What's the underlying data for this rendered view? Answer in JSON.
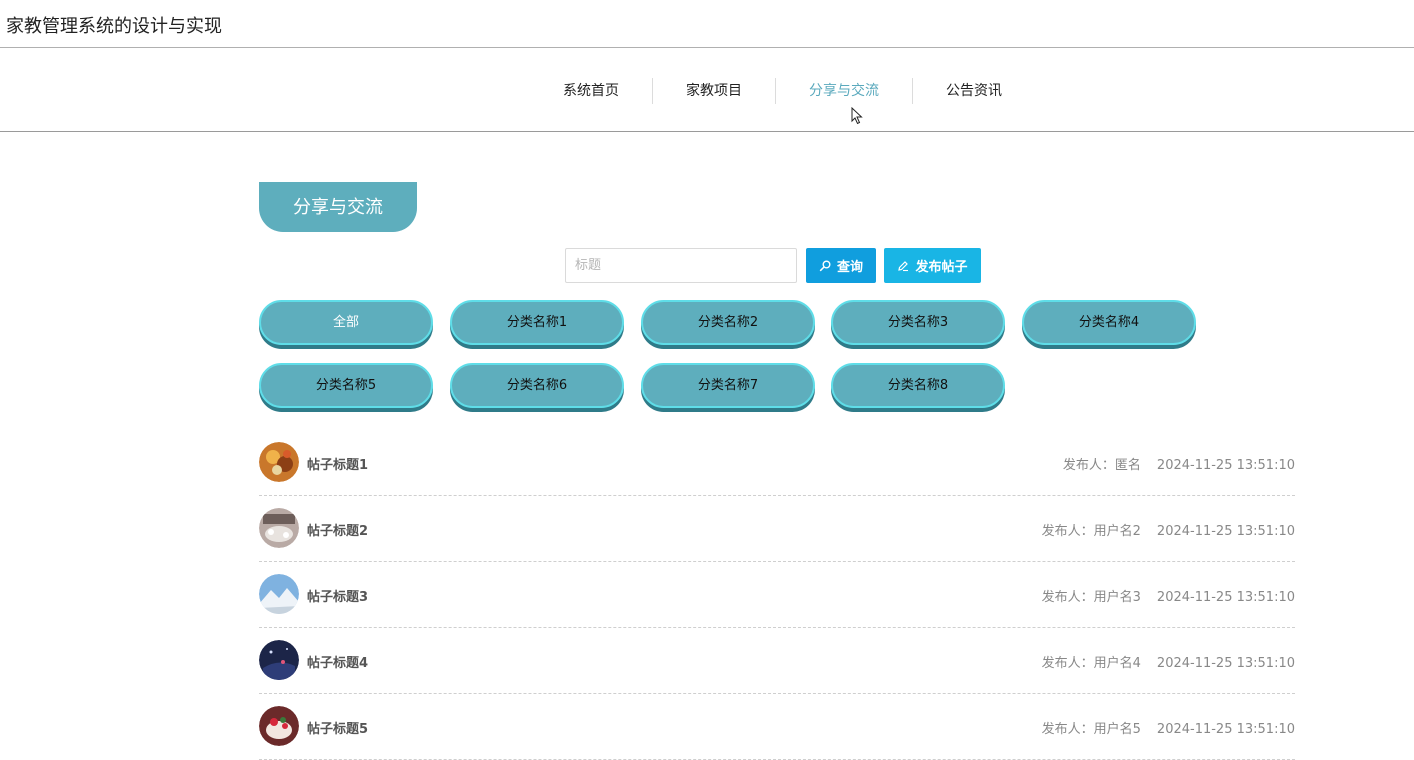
{
  "header": {
    "title": "家教管理系统的设计与实现"
  },
  "nav": {
    "items": [
      {
        "label": "系统首页",
        "active": false
      },
      {
        "label": "家教项目",
        "active": false
      },
      {
        "label": "分享与交流",
        "active": true
      },
      {
        "label": "公告资讯",
        "active": false
      }
    ]
  },
  "section": {
    "title": "分享与交流"
  },
  "search": {
    "placeholder": "标题",
    "value": "",
    "query_label": "查询",
    "post_label": "发布帖子"
  },
  "categories": [
    "全部",
    "分类名称1",
    "分类名称2",
    "分类名称3",
    "分类名称4",
    "分类名称5",
    "分类名称6",
    "分类名称7",
    "分类名称8"
  ],
  "posts": [
    {
      "title": "帖子标题1",
      "author_prefix": "发布人：",
      "author": "匿名",
      "time": "2024-11-25 13:51:10",
      "avatar_icon": "food-photo-icon"
    },
    {
      "title": "帖子标题2",
      "author_prefix": "发布人：",
      "author": "用户名2",
      "time": "2024-11-25 13:51:10",
      "avatar_icon": "dining-photo-icon"
    },
    {
      "title": "帖子标题3",
      "author_prefix": "发布人：",
      "author": "用户名3",
      "time": "2024-11-25 13:51:10",
      "avatar_icon": "snow-mountain-photo-icon"
    },
    {
      "title": "帖子标题4",
      "author_prefix": "发布人：",
      "author": "用户名4",
      "time": "2024-11-25 13:51:10",
      "avatar_icon": "night-scene-photo-icon"
    },
    {
      "title": "帖子标题5",
      "author_prefix": "发布人：",
      "author": "用户名5",
      "time": "2024-11-25 13:51:10",
      "avatar_icon": "cake-photo-icon"
    }
  ],
  "colors": {
    "accent": "#5eaebd",
    "query_button": "#109ede",
    "post_button": "#19b5e5",
    "nav_active": "#5aa9bd"
  }
}
